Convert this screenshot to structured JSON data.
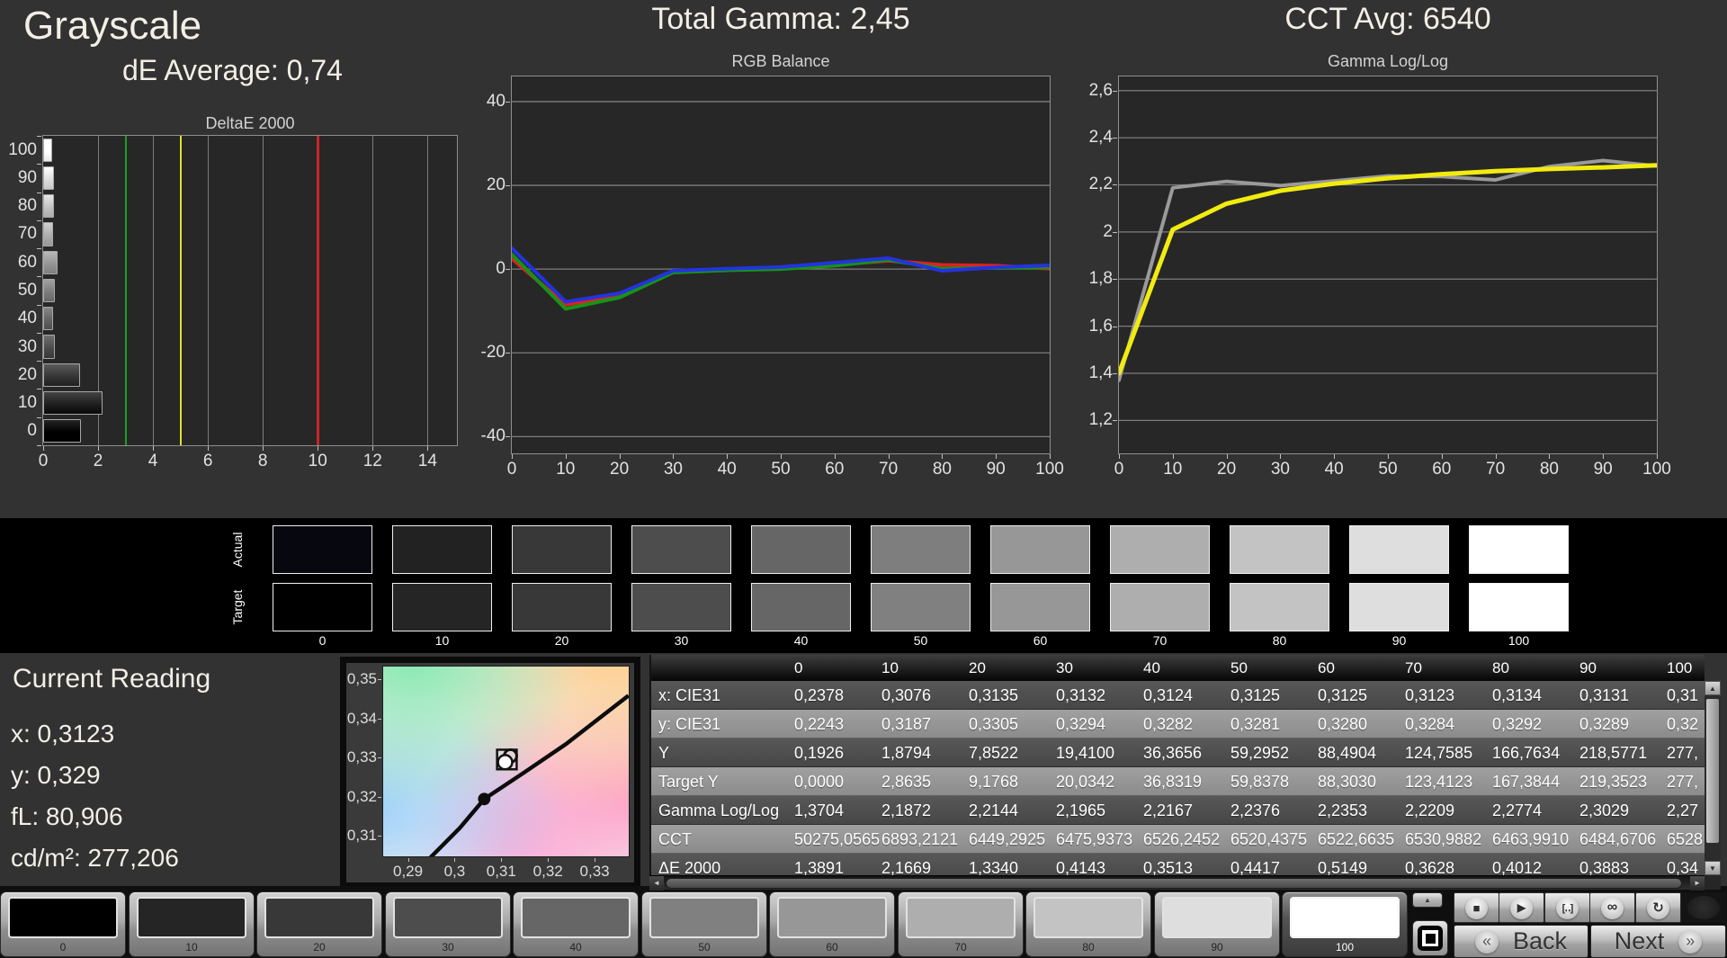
{
  "header": {
    "title": "Grayscale",
    "de_average": "dE Average: 0,74",
    "total_gamma": "Total Gamma: 2,45",
    "cct_avg": "CCT Avg: 6540"
  },
  "chart_data": {
    "deltae": {
      "type": "bar",
      "title": "DeltaE 2000",
      "orientation": "horizontal",
      "categories": [
        "0",
        "10",
        "20",
        "30",
        "40",
        "50",
        "60",
        "70",
        "80",
        "90",
        "100"
      ],
      "values": [
        1.3891,
        2.1669,
        1.334,
        0.4143,
        0.3513,
        0.4417,
        0.5149,
        0.3628,
        0.4012,
        0.3883,
        0.34
      ],
      "bar_grays": [
        0,
        31,
        55,
        76,
        100,
        125,
        149,
        173,
        195,
        222,
        255
      ],
      "xticks": [
        0,
        2,
        4,
        6,
        8,
        10,
        12,
        14
      ],
      "xmax": 15.07,
      "limits": [
        {
          "name": "good",
          "value": 3,
          "color": "#1f9e1f"
        },
        {
          "name": "warn",
          "value": 5,
          "color": "#e0e02a"
        },
        {
          "name": "bad",
          "value": 10,
          "color": "#cc2525"
        }
      ]
    },
    "rgb_balance": {
      "type": "line",
      "title": "RGB Balance",
      "x": [
        0,
        10,
        20,
        30,
        40,
        50,
        60,
        70,
        80,
        90,
        100
      ],
      "ylim": [
        -44,
        46
      ],
      "ytick_labels": [
        "40",
        "20",
        "0",
        "-20",
        "-40"
      ],
      "ytick_values": [
        40,
        20,
        0,
        -20,
        -40
      ],
      "series": [
        {
          "name": "Red",
          "color": "#dd2222",
          "values": [
            2.5,
            -8.5,
            -6.3,
            -0.6,
            0.0,
            0.2,
            1.0,
            2.0,
            1.0,
            0.8,
            0.1
          ]
        },
        {
          "name": "Green",
          "color": "#169416",
          "values": [
            3.5,
            -9.5,
            -6.8,
            -0.8,
            -0.3,
            0.0,
            0.8,
            2.2,
            0.1,
            0.3,
            0.4
          ]
        },
        {
          "name": "Blue",
          "color": "#2433de",
          "values": [
            5.0,
            -7.8,
            -5.8,
            -0.4,
            0.1,
            0.5,
            1.5,
            2.6,
            -0.4,
            0.4,
            0.9
          ]
        }
      ]
    },
    "gamma_loglog": {
      "type": "line",
      "title": "Gamma Log/Log",
      "x": [
        0,
        10,
        20,
        30,
        40,
        50,
        60,
        70,
        80,
        90,
        100
      ],
      "ylim": [
        1.06,
        2.66
      ],
      "ytick_labels": [
        "2,6",
        "2,4",
        "2,2",
        "2",
        "1,8",
        "1,6",
        "1,4",
        "1,2"
      ],
      "ytick_values": [
        2.6,
        2.4,
        2.2,
        2.0,
        1.8,
        1.6,
        1.4,
        1.2
      ],
      "series": [
        {
          "name": "Measured",
          "color": "#9a9a9a",
          "width": 4,
          "values": [
            1.3704,
            2.1872,
            2.2144,
            2.1965,
            2.2167,
            2.2376,
            2.2353,
            2.2209,
            2.2774,
            2.3029,
            2.28
          ]
        },
        {
          "name": "Target",
          "color": "#f2eb10",
          "width": 5,
          "values": [
            1.4,
            2.01,
            2.12,
            2.175,
            2.205,
            2.228,
            2.245,
            2.258,
            2.267,
            2.274,
            2.283
          ]
        }
      ]
    },
    "cie_zoom": {
      "type": "scatter",
      "title": "CIE xy zoom",
      "xticks": [
        "0,29",
        "0,3",
        "0,31",
        "0,32",
        "0,33"
      ],
      "xtick_values": [
        0.29,
        0.3,
        0.31,
        0.32,
        0.33
      ],
      "yticks": [
        "0,35",
        "0,34",
        "0,33",
        "0,32",
        "0,31"
      ],
      "ytick_values": [
        0.35,
        0.34,
        0.33,
        0.32,
        0.31
      ],
      "xlim": [
        0.2845,
        0.3375
      ],
      "ylim": [
        0.3045,
        0.3535
      ],
      "locus": [
        [
          0.2945,
          0.304
        ],
        [
          0.301,
          0.3118
        ],
        [
          0.3063,
          0.3193
        ],
        [
          0.315,
          0.3262
        ],
        [
          0.324,
          0.3335
        ],
        [
          0.3375,
          0.346
        ]
      ],
      "measured_point": [
        0.3063,
        0.3193
      ],
      "target_marker": [
        0.3112,
        0.3295
      ]
    }
  },
  "band": {
    "row_labels": [
      "Actual",
      "Target"
    ],
    "levels": [
      "0",
      "10",
      "20",
      "30",
      "40",
      "50",
      "60",
      "70",
      "80",
      "90",
      "100"
    ],
    "actual": [
      "#07070f",
      "#222222",
      "#383838",
      "#4d4d4d",
      "#666666",
      "#7e7e7e",
      "#979797",
      "#aeaeae",
      "#c3c3c3",
      "#dedede",
      "#ffffff"
    ],
    "target": [
      "#000000",
      "#252525",
      "#383838",
      "#4d4d4d",
      "#666666",
      "#808080",
      "#979797",
      "#aeaeae",
      "#c3c3c3",
      "#dedede",
      "#ffffff"
    ]
  },
  "reading": {
    "title": "Current Reading",
    "lines": [
      "x: 0,3123",
      "y: 0,329",
      "fL: 80,906",
      "cd/m²: 277,206"
    ]
  },
  "table": {
    "columns": [
      "0",
      "10",
      "20",
      "30",
      "40",
      "50",
      "60",
      "70",
      "80",
      "90",
      "100"
    ],
    "rows": [
      {
        "label": "x: CIE31",
        "values": [
          "0,2378",
          "0,3076",
          "0,3135",
          "0,3132",
          "0,3124",
          "0,3125",
          "0,3125",
          "0,3123",
          "0,3134",
          "0,3131",
          "0,31"
        ]
      },
      {
        "label": "y: CIE31",
        "values": [
          "0,2243",
          "0,3187",
          "0,3305",
          "0,3294",
          "0,3282",
          "0,3281",
          "0,3280",
          "0,3284",
          "0,3292",
          "0,3289",
          "0,32"
        ]
      },
      {
        "label": "Y",
        "values": [
          "0,1926",
          "1,8794",
          "7,8522",
          "19,4100",
          "36,3656",
          "59,2952",
          "88,4904",
          "124,7585",
          "166,7634",
          "218,5771",
          "277,"
        ]
      },
      {
        "label": "Target Y",
        "values": [
          "0,0000",
          "2,8635",
          "9,1768",
          "20,0342",
          "36,8319",
          "59,8378",
          "88,3030",
          "123,4123",
          "167,3844",
          "219,3523",
          "277,"
        ]
      },
      {
        "label": "Gamma Log/Log",
        "values": [
          "1,3704",
          "2,1872",
          "2,2144",
          "2,1965",
          "2,2167",
          "2,2376",
          "2,2353",
          "2,2209",
          "2,2774",
          "2,3029",
          "2,27"
        ]
      },
      {
        "label": "CCT",
        "values": [
          "50275,0565",
          "6893,2121",
          "6449,2925",
          "6475,9373",
          "6526,2452",
          "6520,4375",
          "6522,6635",
          "6530,9882",
          "6463,9910",
          "6484,6706",
          "6528"
        ]
      },
      {
        "label": "ΔE 2000",
        "values": [
          "1,3891",
          "2,1669",
          "1,3340",
          "0,4143",
          "0,3513",
          "0,4417",
          "0,5149",
          "0,3628",
          "0,4012",
          "0,3883",
          "0,34"
        ]
      }
    ],
    "scroll_icons": {
      "left": "◄",
      "right": "►",
      "up": "▲",
      "down": "▼"
    }
  },
  "bottom": {
    "tiles": [
      {
        "label": "0",
        "color": "#000000"
      },
      {
        "label": "10",
        "color": "#252525"
      },
      {
        "label": "20",
        "color": "#383838"
      },
      {
        "label": "30",
        "color": "#4d4d4d"
      },
      {
        "label": "40",
        "color": "#666666"
      },
      {
        "label": "50",
        "color": "#808080"
      },
      {
        "label": "60",
        "color": "#979797"
      },
      {
        "label": "70",
        "color": "#aeaeae"
      },
      {
        "label": "80",
        "color": "#c3c3c3"
      },
      {
        "label": "90",
        "color": "#dedede"
      },
      {
        "label": "100",
        "color": "#ffffff"
      }
    ],
    "selected_index": 10,
    "back_label": "Back",
    "next_label": "Next",
    "icons": {
      "up": "▲",
      "stop": "■",
      "play": "▶",
      "frame": "[‥]",
      "loop": "∞",
      "refresh": "↻",
      "back": "«",
      "next": "»"
    }
  }
}
